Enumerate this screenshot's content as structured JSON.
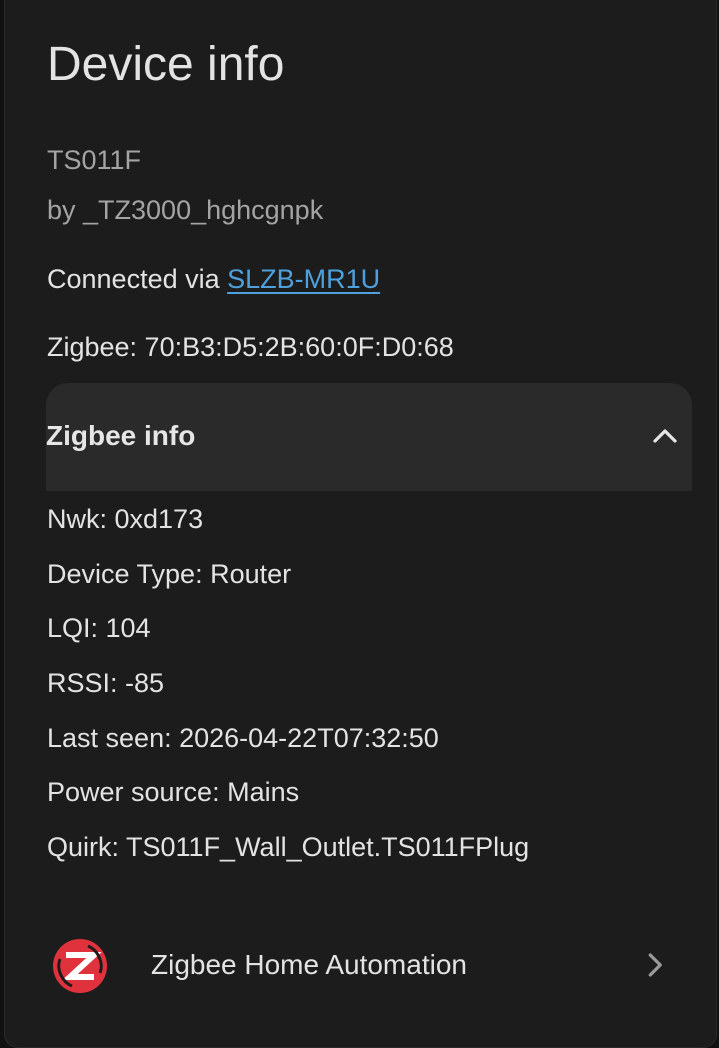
{
  "card": {
    "title": "Device info",
    "model": "TS011F",
    "manufacturer": "by _TZ3000_hghcgnpk",
    "connected_prefix": "Connected via ",
    "connected_link": "SLZB-MR1U",
    "zigbee_address": "Zigbee: 70:B3:D5:2B:60:0F:D0:68"
  },
  "zigbee_info": {
    "title": "Zigbee info",
    "expanded": true,
    "chevron_icon": "chevron-up-icon",
    "lines": [
      "Nwk: 0xd173",
      "Device Type: Router",
      "LQI: 104",
      "RSSI: -85",
      "Last seen: 2026-04-22T07:32:50",
      "Power source: Mains",
      "Quirk: TS011F_Wall_Outlet.TS011FPlug"
    ]
  },
  "integration": {
    "label": "Zigbee Home Automation",
    "logo_icon": "zigbee-logo-icon",
    "chevron_icon": "chevron-right-icon",
    "logo_color": "#e0323c"
  },
  "colors": {
    "background": "#1c1c1c",
    "link": "#4ea1dc",
    "text_primary": "#e3e3e3",
    "text_secondary": "#a4a4a4",
    "expander_bg": "#2a2a2a"
  }
}
